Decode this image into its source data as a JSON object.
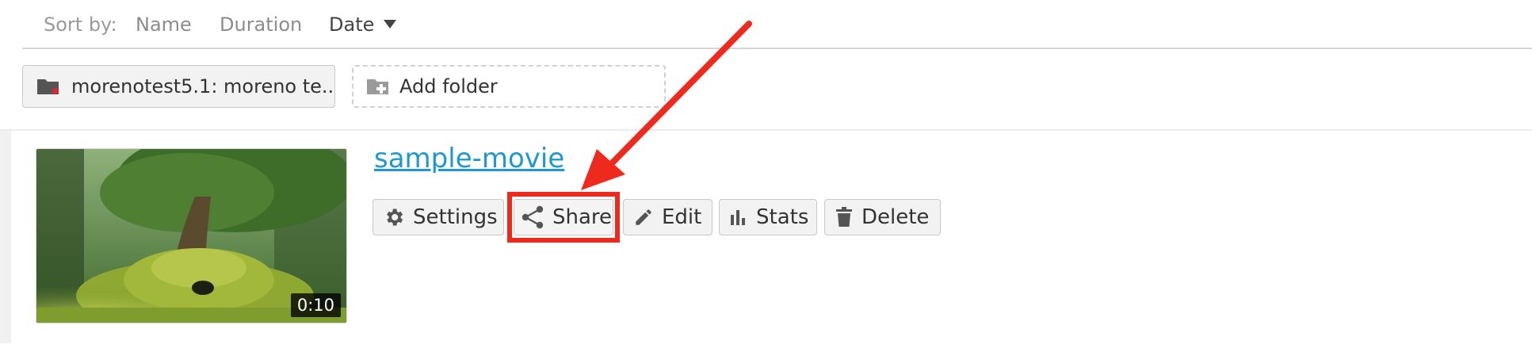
{
  "sort": {
    "label": "Sort by:",
    "options": [
      "Name",
      "Duration",
      "Date"
    ],
    "active": "Date"
  },
  "folders": {
    "current": "morenotest5.1: moreno te...",
    "add_label": "Add folder"
  },
  "video": {
    "title": "sample-movie",
    "duration": "0:10"
  },
  "actions": {
    "settings": "Settings",
    "share": "Share",
    "edit": "Edit",
    "stats": "Stats",
    "delete": "Delete"
  },
  "colors": {
    "link": "#1f98cf",
    "annotation": "#ee2a1f",
    "folder_badge": "#e0262b"
  },
  "icons": {
    "sort_caret": "caret-down-icon",
    "folder": "folder-icon",
    "add_folder": "folder-plus-icon",
    "settings": "gear-icon",
    "share": "share-icon",
    "edit": "pencil-icon",
    "stats": "bar-chart-icon",
    "delete": "trash-icon"
  }
}
